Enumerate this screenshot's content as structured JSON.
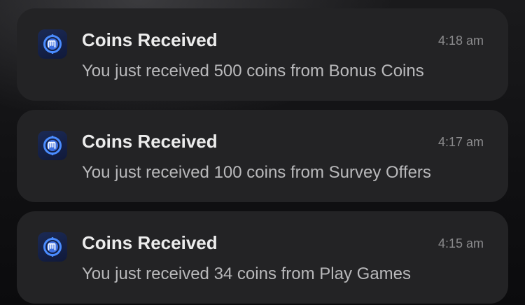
{
  "notifications": [
    {
      "icon": "app-coin-icon",
      "title": "Coins Received",
      "time": "4:18 am",
      "message": "You just received 500 coins from Bonus Coins"
    },
    {
      "icon": "app-coin-icon",
      "title": "Coins Received",
      "time": "4:17 am",
      "message": "You just received 100 coins from Survey Offers"
    },
    {
      "icon": "app-coin-icon",
      "title": "Coins Received",
      "time": "4:15 am",
      "message": "You just received 34 coins from Play Games"
    }
  ],
  "colors": {
    "card_background": "#232325",
    "icon_accent": "#4a8cff"
  }
}
